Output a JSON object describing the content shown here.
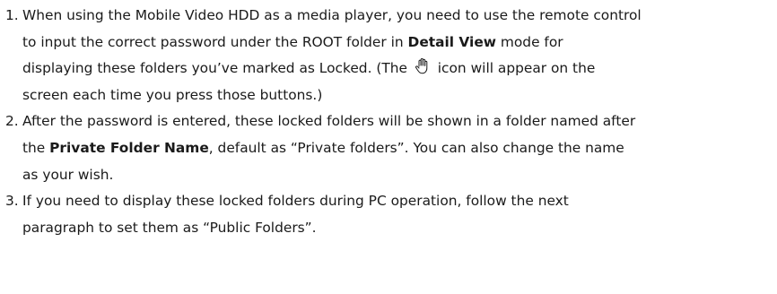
{
  "items": [
    {
      "number": "1.",
      "l1": "When using the Mobile Video HDD as a media player, you need to use the remote control",
      "l2a": "to input the correct password under the ROOT folder in ",
      "l2b": "Detail View",
      "l2c": " mode for",
      "l3a": "displaying these folders you’ve marked as Locked. (The ",
      "l3b": " icon will appear on the",
      "l4": "screen each time you press those buttons.)",
      "icon": "hand-icon"
    },
    {
      "number": "2.",
      "l1": "After the password is entered, these locked folders will be shown in a folder named after",
      "l2a": "the ",
      "l2b": "Private Folder Name",
      "l2c": ", default as “Private folders”. You can also change the name",
      "l3": "as your wish."
    },
    {
      "number": "3.",
      "l1": "If you need to display these locked folders during PC operation, follow the next",
      "l2": "paragraph to set them as “Public Folders”."
    }
  ]
}
